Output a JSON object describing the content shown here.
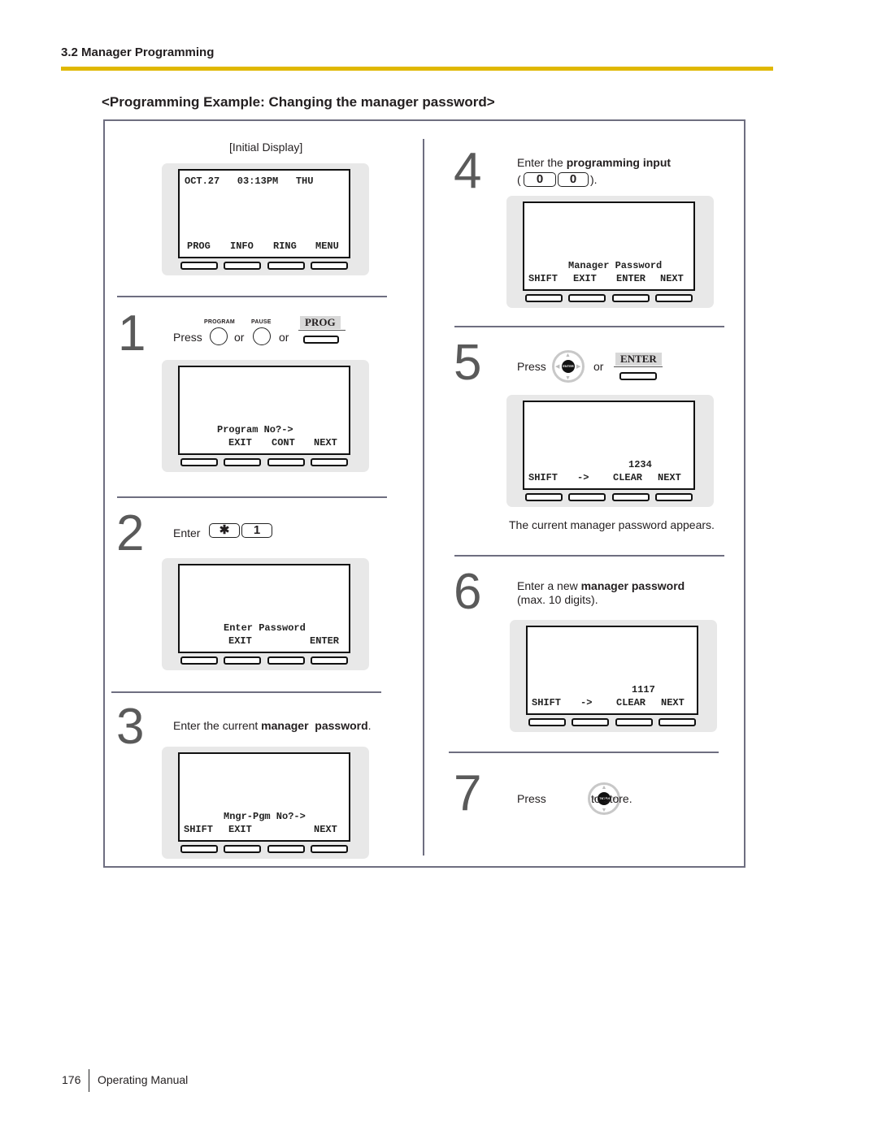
{
  "header": {
    "section": "3.2 Manager Programming",
    "example_title": "<Programming Example: Changing the manager password>"
  },
  "initial": {
    "caption": "[Initial Display]",
    "lcd": {
      "top_line": "OCT.27   03:13PM   THU",
      "keys": [
        "PROG",
        "INFO",
        "RING",
        "MENU"
      ]
    }
  },
  "steps": [
    {
      "number": "1",
      "press": "Press",
      "or1": "or",
      "or2": "or",
      "btn1_label": "PROGRAM",
      "btn2_label": "PAUSE",
      "softkey_label": "PROG",
      "lcd": {
        "message": "Program No?->",
        "keys": [
          "",
          "EXIT",
          "CONT",
          "NEXT"
        ]
      }
    },
    {
      "number": "2",
      "enter": "Enter",
      "keys": [
        "✱",
        "1"
      ],
      "lcd": {
        "message": "Enter Password",
        "keys": [
          "",
          "EXIT",
          "",
          "ENTER"
        ]
      }
    },
    {
      "number": "3",
      "text_pre": "Enter the current ",
      "text_bold": "manager  password",
      "text_post": ".",
      "lcd": {
        "message": "Mngr-Pgm No?->",
        "keys": [
          "SHIFT",
          "EXIT",
          "",
          "NEXT"
        ]
      }
    },
    {
      "number": "4",
      "text_pre": "Enter the ",
      "text_bold": "programming input",
      "paren_open": "(",
      "paren_close": ").",
      "keys": [
        "0",
        "0"
      ],
      "lcd": {
        "message": "Manager Password",
        "keys": [
          "SHIFT",
          "EXIT",
          "ENTER",
          "NEXT"
        ]
      }
    },
    {
      "number": "5",
      "press": "Press",
      "or": "or",
      "nav_center": "ENTER",
      "softkey_label": "ENTER",
      "lcd": {
        "message": "1234",
        "keys": [
          "SHIFT",
          "->",
          "CLEAR",
          "NEXT"
        ]
      },
      "note": "The current manager password appears."
    },
    {
      "number": "6",
      "text_pre": "Enter a new ",
      "text_bold": "manager password",
      "text_line2": "(max. 10 digits).",
      "lcd": {
        "message": "1117",
        "keys": [
          "SHIFT",
          "->",
          "CLEAR",
          "NEXT"
        ]
      }
    },
    {
      "number": "7",
      "press": "Press",
      "nav_center": "ENTER",
      "after": "to store."
    }
  ],
  "footer": {
    "page": "176",
    "title": "Operating Manual"
  }
}
